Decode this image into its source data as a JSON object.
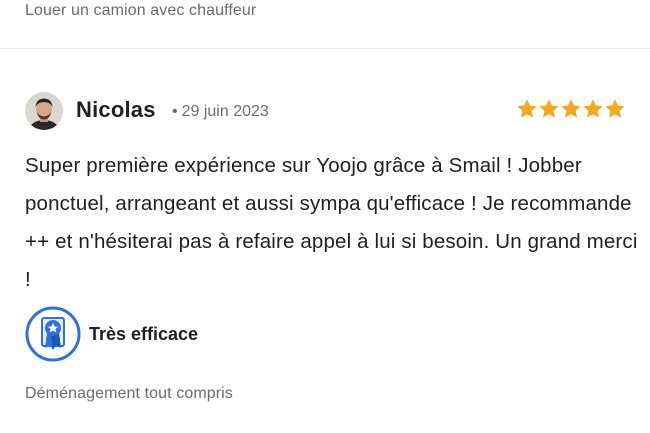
{
  "header": {
    "category": "Louer un camion avec chauffeur"
  },
  "review": {
    "author": "Nicolas",
    "date": "29 juin 2023",
    "separator": "•",
    "rating": 5,
    "rating_max": 5,
    "star_color": "#f5a623",
    "text": "Super première expérience sur Yoojo grâce à Smail ! Jobber ponctuel, arrangeant et aussi sympa qu'efficace ! Je recommande ++ et n'hésiterai pas à refaire appel à lui si besoin. Un grand merci !",
    "badge": {
      "icon": "award-ribbon-icon",
      "label": "Très efficace",
      "color": "#2f6fde"
    },
    "category": "Déménagement tout compris"
  }
}
